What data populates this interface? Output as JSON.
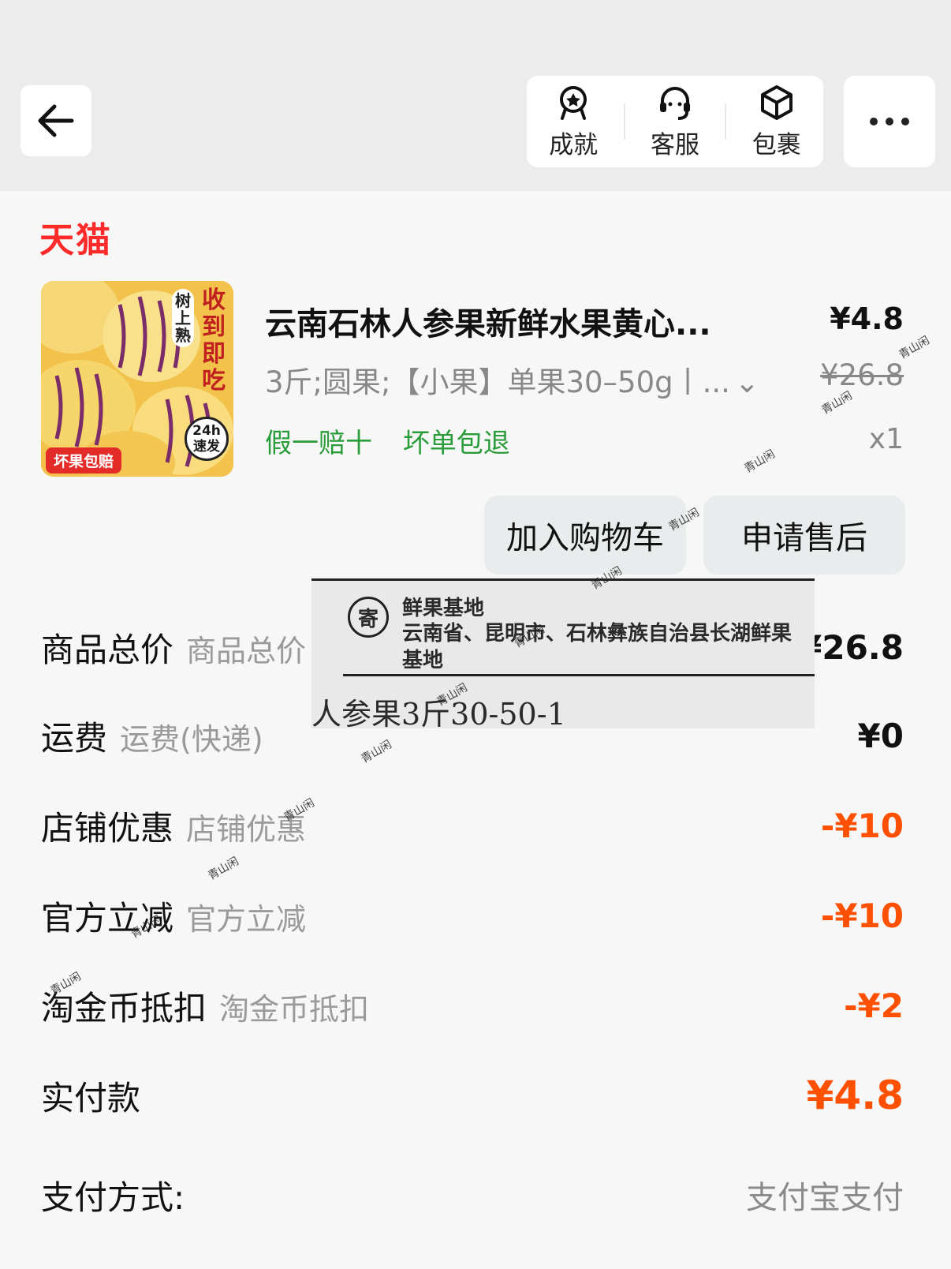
{
  "header": {
    "actions": [
      {
        "label": "成就",
        "icon": "medal-icon"
      },
      {
        "label": "客服",
        "icon": "headset-icon"
      },
      {
        "label": "包裹",
        "icon": "package-icon"
      }
    ]
  },
  "order": {
    "shop_name": "天猫",
    "product": {
      "thumb_vertical_text": "收到即吃",
      "thumb_side_text": "树上熟",
      "thumb_stamp": "24h 速发",
      "thumb_tag": "坏果包赔",
      "title": "云南石林人参果新鲜水果黄心...",
      "price": "¥4.8",
      "spec": "3斤;圆果;【小果】单果30–50g丨...",
      "original_price": "¥26.8",
      "guarantees": [
        "假一赔十",
        "坏单包退"
      ],
      "quantity": "x1"
    },
    "buttons": {
      "add_to_cart": "加入购物车",
      "after_sales": "申请售后"
    }
  },
  "label_photo": {
    "line1": "鲜果基地",
    "line2": "云南省、昆明市、石林彝族自治县长湖鲜果",
    "line3": "基地",
    "line4": "人参果3斤30-50-1",
    "logo": "寄"
  },
  "summary": [
    {
      "label": "商品总价",
      "sub": "商品总价",
      "value": "¥26.8",
      "style": "normal"
    },
    {
      "label": "运费",
      "sub": "运费(快递)",
      "value": "¥0",
      "style": "normal"
    },
    {
      "label": "店铺优惠",
      "sub": "店铺优惠",
      "value": "-¥10",
      "style": "orange"
    },
    {
      "label": "官方立减",
      "sub": "官方立减",
      "value": "-¥10",
      "style": "orange"
    },
    {
      "label": "淘金币抵扣",
      "sub": "淘金币抵扣",
      "value": "-¥2",
      "style": "orange"
    },
    {
      "label": "实付款",
      "sub": "",
      "value": "¥4.8",
      "style": "orange"
    },
    {
      "label": "支付方式:",
      "sub": "",
      "value": "支付宝支付",
      "style": "gray"
    }
  ],
  "watermark": "青山闲",
  "colors": {
    "tmall_red": "#ff2a2a",
    "guarantee_green": "#2a9c3a",
    "discount_orange": "#ff5000"
  }
}
